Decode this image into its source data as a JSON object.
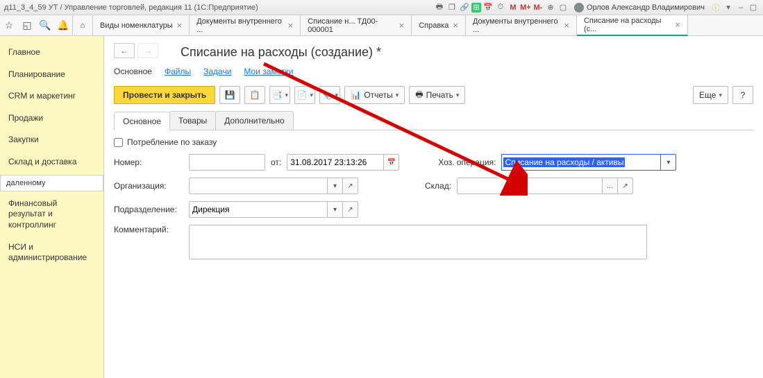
{
  "window": {
    "title": "д11_3_4_59 УТ / Управление торговлей, редакция 11  (1С:Предприятие)",
    "user": "Орлов Александр Владимирович",
    "m_labels": [
      "M",
      "M+",
      "M-"
    ]
  },
  "tabs": [
    {
      "label": "Виды номенклатуры",
      "closable": true
    },
    {
      "label": "Документы внутреннего ...",
      "closable": true
    },
    {
      "label": "Списание н... ТД00-000001",
      "closable": true
    },
    {
      "label": "Справка",
      "closable": true
    },
    {
      "label": "Документы внутреннего ...",
      "closable": true
    },
    {
      "label": "Списание на расходы (с...",
      "closable": true,
      "active": true
    }
  ],
  "sidebar": [
    "Главное",
    "Планирование",
    "CRM и маркетинг",
    "Продажи",
    "Закупки",
    "Склад и доставка",
    "даленному",
    "Финансовый результат и контроллинг",
    "НСИ и администрирование"
  ],
  "page": {
    "title": "Списание на расходы (создание) *",
    "links": [
      "Основное",
      "Файлы",
      "Задачи",
      "Мои заметки"
    ],
    "primary_btn": "Провести и закрыть",
    "reports_btn": "Отчеты",
    "print_btn": "Печать",
    "more_btn": "Еще",
    "subtabs": [
      "Основное",
      "Товары",
      "Дополнительно"
    ],
    "consume_by_order": "Потребление по заказу",
    "labels": {
      "number": "Номер:",
      "from": "от:",
      "operation": "Хоз. операция:",
      "organization": "Организация:",
      "warehouse": "Склад:",
      "division": "Подразделение:",
      "comment": "Комментарий:"
    },
    "values": {
      "number": "",
      "date": "31.08.2017 23:13:26",
      "operation": "Списание на расходы / активы",
      "organization": "",
      "warehouse": "",
      "division": "Дирекция",
      "comment": ""
    }
  }
}
